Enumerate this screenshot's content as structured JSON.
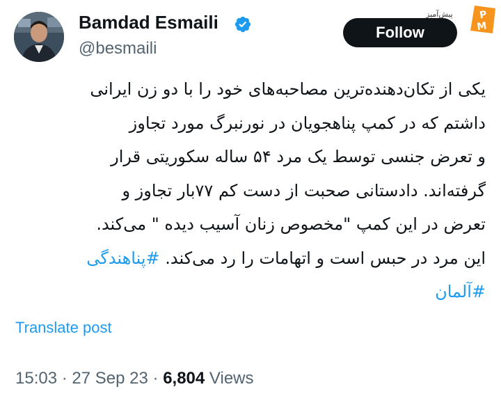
{
  "author": {
    "name": "Bamdad Esmaili",
    "handle": "@besmaili",
    "verified": true,
    "verified_color": "#1d9bf0"
  },
  "follow_button": {
    "label": "Follow"
  },
  "watermark": {
    "text": "پیش‌آمیز",
    "logo_text": "P M",
    "logo_color": "#f7941d"
  },
  "tweet": {
    "lines": [
      "یکی از تکان‌دهنده‌ترین مصاحبه‌های خود را با دو زن ایرانی",
      "داشتم که در کمپ پناهجویان در نورنبرگ مورد تجاوز",
      "و تعرض جنسی توسط یک مرد ۵۴ ساله سکوریتی قرار",
      "گرفته‌اند. دادستانی صحبت از دست کم ۷۷بار تجاوز و",
      "تعرض در این کمپ \"مخصوص زنان آسیب دیده \" می‌کند.",
      "این مرد در حبس است و اتهامات را رد می‌کند."
    ],
    "hashtag_1": "#پناهندگی",
    "hashtag_2": "#آلمان",
    "link_color": "#1d9bf0"
  },
  "translate_label": "Translate post",
  "meta": {
    "time": "15:03",
    "separator": "·",
    "date": "27 Sep 23",
    "views_count": "6,804",
    "views_label": "Views"
  }
}
